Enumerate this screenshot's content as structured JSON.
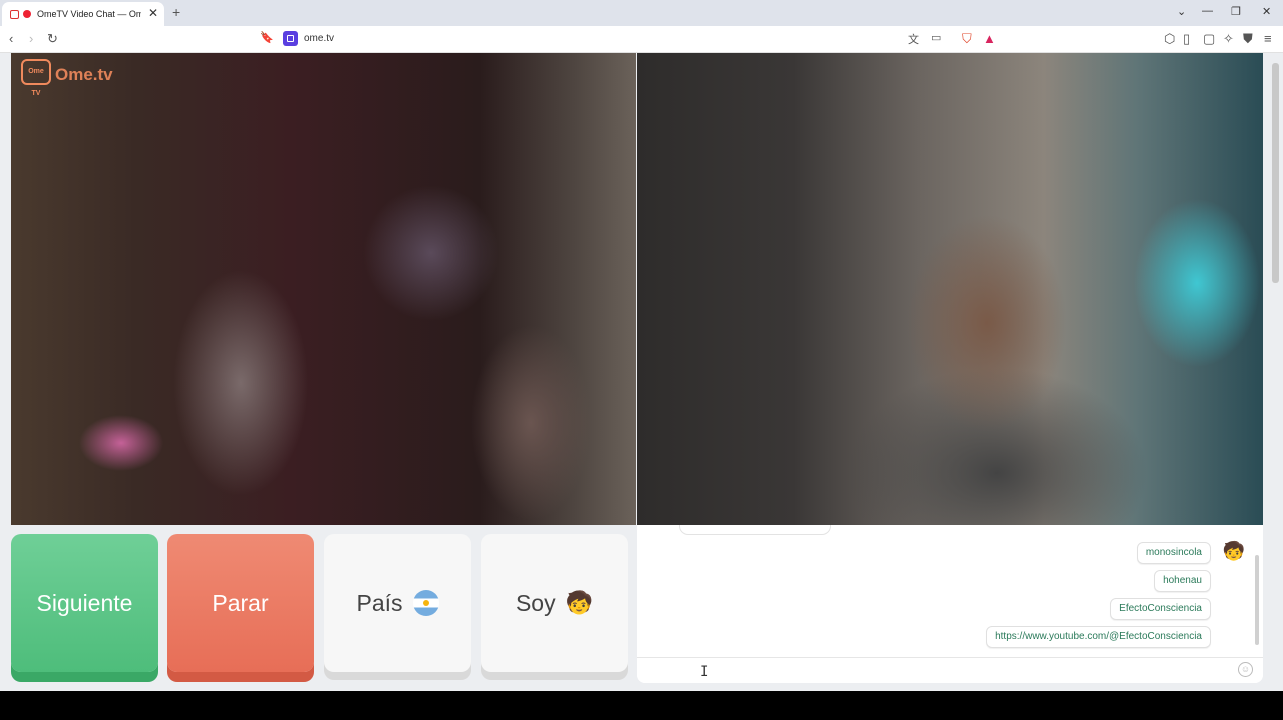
{
  "browser": {
    "tab_title": "OmeTV Video Chat — Omeg",
    "tab_close": "✕",
    "new_tab": "+",
    "url": "ome.tv",
    "win_controls": [
      "⌄",
      "—",
      "❐",
      "✕"
    ],
    "nav_icons": [
      "back-icon",
      "forward-icon",
      "reload-icon",
      "bookmark-icon"
    ]
  },
  "video": {
    "watermark": "Ome.tv",
    "watermark_badge": "Ome TV"
  },
  "controls": {
    "next_label": "Siguiente",
    "stop_label": "Parar",
    "country_label": "País",
    "soy_label": "Soy",
    "soy_emoji": "🧒",
    "colors": {
      "next": "#5cc68a",
      "stop": "#ea7a63"
    }
  },
  "chat": {
    "messages": [
      "monosincola",
      "hohenau",
      "EfectoConsciencia",
      "https://www.youtube.com/@EfectoConsciencia"
    ],
    "avatar_emoji": "🧒",
    "input_value": "",
    "smile_icon": "☺"
  }
}
